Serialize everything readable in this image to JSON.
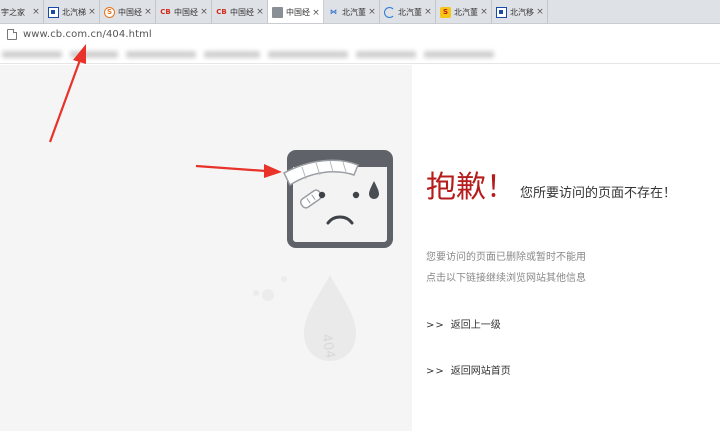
{
  "browser": {
    "tabs": [
      {
        "title": "宇之家",
        "favicon": "blue-square-icon"
      },
      {
        "title": "北汽梯航",
        "favicon": "blue-square-icon"
      },
      {
        "title": "中国经营",
        "favicon": "orange-s-icon"
      },
      {
        "title": "中国经营",
        "favicon": "cb-icon"
      },
      {
        "title": "中国经营",
        "favicon": "cb-icon"
      },
      {
        "title": "中国经营",
        "favicon": "page-icon",
        "active": true
      },
      {
        "title": "北汽董事",
        "favicon": "fish-icon"
      },
      {
        "title": "北汽董事",
        "favicon": "loading-ring-icon"
      },
      {
        "title": "北汽董事",
        "favicon": "s-logo-icon"
      },
      {
        "title": "北汽移和",
        "favicon": "blue-square-icon"
      }
    ],
    "close_glyph": "×",
    "url": "www.cb.com.cn/404.html"
  },
  "page": {
    "sorry": "抱歉！",
    "sorry_sub": "您所要访问的页面不存在！",
    "desc_line1": "您要访问的页面已删除或暂时不能用",
    "desc_line2": "点击以下链接继续浏览网站其他信息",
    "link_back": {
      "arrows": ">>",
      "label": "返回上一级"
    },
    "link_home": {
      "arrows": ">>",
      "label": "返回网站首页"
    },
    "watermark": "404"
  },
  "colors": {
    "accent_red": "#b51c1c",
    "annotation_red": "#e8322a"
  }
}
